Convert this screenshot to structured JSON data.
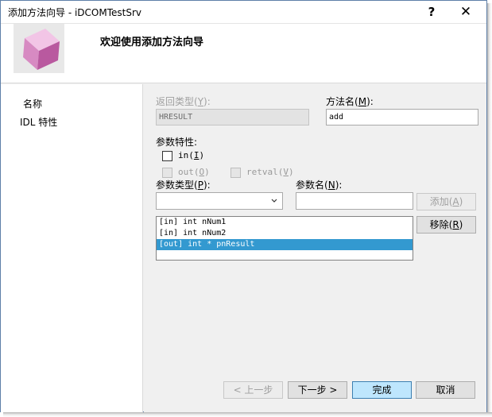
{
  "window": {
    "title": "添加方法向导 - iDCOMTestSrv",
    "help_symbol": "?",
    "close_symbol": "✕"
  },
  "header": {
    "welcome": "欢迎使用添加方法向导",
    "icon": "wizard-cube-icon"
  },
  "nav": {
    "items": [
      "名称",
      "IDL 特性"
    ]
  },
  "form": {
    "return_type": {
      "label": "返回类型",
      "hotkey": "Y",
      "value": "HRESULT"
    },
    "method_name": {
      "label": "方法名",
      "hotkey": "M",
      "value": "add"
    },
    "param_attrs": {
      "label": "参数特性:",
      "in": {
        "text": "in",
        "hotkey": "I",
        "checked": false
      },
      "out": {
        "text": "out",
        "hotkey": "O",
        "checked": false,
        "disabled": true
      },
      "retval": {
        "text": "retval",
        "hotkey": "V",
        "checked": false,
        "disabled": true
      }
    },
    "param_type": {
      "label": "参数类型",
      "hotkey": "P",
      "value": ""
    },
    "param_name": {
      "label": "参数名",
      "hotkey": "N",
      "value": ""
    },
    "add_button": {
      "label": "添加",
      "hotkey": "A"
    },
    "remove_button": {
      "label": "移除",
      "hotkey": "R"
    },
    "params": [
      {
        "text": "[in] int nNum1",
        "selected": false
      },
      {
        "text": "[in] int nNum2",
        "selected": false
      },
      {
        "text": "[out] int * pnResult",
        "selected": true
      }
    ]
  },
  "footer": {
    "prev": "< 上一步",
    "next": "下一步 >",
    "finish": "完成",
    "cancel": "取消"
  },
  "colors": {
    "selection": "#3399d0",
    "primary_button": "#bee6fd"
  }
}
